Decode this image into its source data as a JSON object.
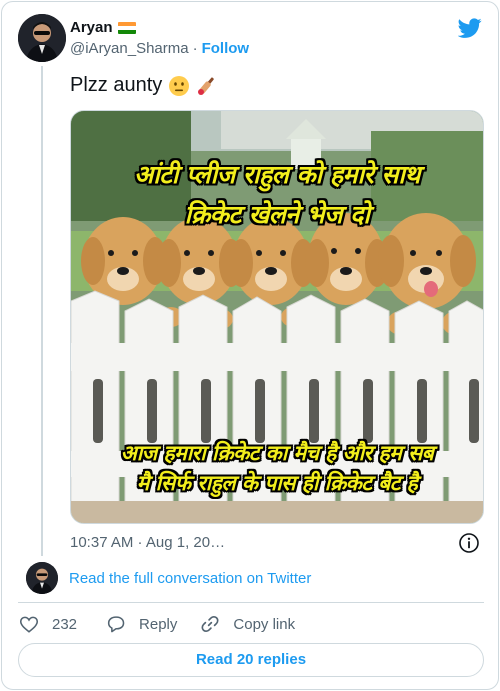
{
  "author": {
    "name": "Aryan",
    "handle": "@iAryan_Sharma",
    "separator": "·",
    "follow_label": "Follow",
    "flag_icon": "india-flag-icon"
  },
  "tweet": {
    "text": "Plzz aunty",
    "emojis": [
      "neutral-face-emoji",
      "cricket-bat-emoji"
    ],
    "meme": {
      "top_line_1": "आंटी प्लीज राहुल को हमारे साथ",
      "top_line_2": "क्रिकेट खेलने भेज दो",
      "bottom_line_1": "आज हमारा क्रिकेट का मैच है और हम सब",
      "bottom_line_2": "मै सिर्फ राहुल के पास ही क्रिकेट बैट है"
    },
    "timestamp": "10:37 AM · Aug 1, 20…"
  },
  "conversation": {
    "link_label": "Read the full conversation on Twitter"
  },
  "actions": {
    "like_count": "232",
    "reply_label": "Reply",
    "copy_label": "Copy link"
  },
  "read_replies_label": "Read 20 replies",
  "colors": {
    "accent": "#1d9bf0",
    "text_secondary": "#536471",
    "border": "#cfd9de",
    "meme_text": "#f2ee1c"
  }
}
